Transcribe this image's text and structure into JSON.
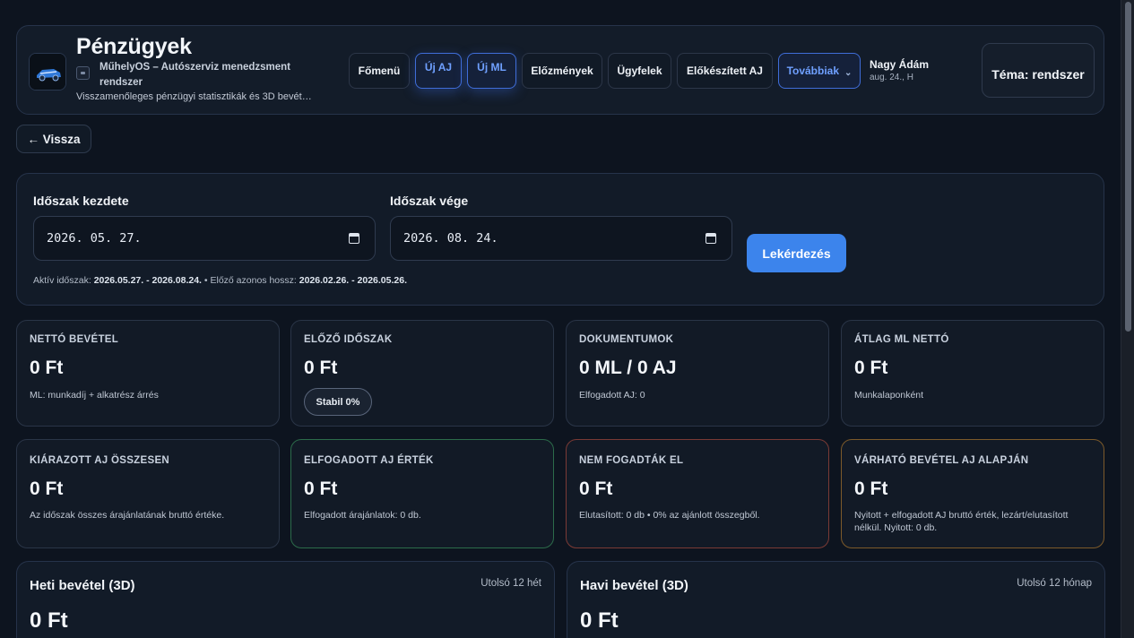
{
  "header": {
    "title": "Pénzügyek",
    "subtitle": "MűhelyOS – Autószerviz menedzsment rendszer",
    "tagline": "Visszamenőleges pénzügyi statisztikák és 3D bevét…",
    "nav": [
      {
        "label": "Főmenü"
      },
      {
        "label": "Új AJ"
      },
      {
        "label": "Új ML"
      },
      {
        "label": "Előzmények"
      },
      {
        "label": "Ügyfelek"
      },
      {
        "label": "Előkészített AJ"
      },
      {
        "label": "Továbbiak"
      }
    ],
    "user_name": "Nagy Ádám",
    "user_date": "aug. 24., H",
    "theme_label": "Téma: rendszer"
  },
  "back_label": "← Vissza",
  "filter": {
    "start_label": "Időszak kezdete",
    "start_value": "2026. 05. 27.",
    "end_label": "Időszak vége",
    "end_value": "2026. 08. 24.",
    "query_label": "Lekérdezés",
    "active_prefix": "Aktív időszak:",
    "active_range": "2026.05.27. - 2026.08.24.",
    "prev_prefix": "• Előző azonos hossz:",
    "prev_range": "2026.02.26. - 2026.05.26."
  },
  "cards_row1": [
    {
      "label": "NETTÓ BEVÉTEL",
      "value": "0 Ft",
      "note": "ML: munkadíj + alkatrész árrés"
    },
    {
      "label": "ELŐZŐ IDŐSZAK",
      "value": "0 Ft",
      "badge": "Stabil 0%"
    },
    {
      "label": "DOKUMENTUMOK",
      "value": "0 ML / 0 AJ",
      "note": "Elfogadott AJ: 0"
    },
    {
      "label": "ÁTLAG ML NETTÓ",
      "value": "0 Ft",
      "note": "Munkalaponként"
    }
  ],
  "cards_row2": [
    {
      "label": "KIÁRAZOTT AJ ÖSSZESEN",
      "value": "0 Ft",
      "note": "Az időszak összes árajánlatának bruttó értéke."
    },
    {
      "label": "ELFOGADOTT AJ ÉRTÉK",
      "value": "0 Ft",
      "note": "Elfogadott árajánlatok: 0 db."
    },
    {
      "label": "NEM FOGADTÁK EL",
      "value": "0 Ft",
      "note": "Elutasított: 0 db • 0% az ajánlott összegből."
    },
    {
      "label": "VÁRHATÓ BEVÉTEL AJ ALAPJÁN",
      "value": "0 Ft",
      "note": "Nyitott + elfogadott AJ bruttó érték, lezárt/elutasított nélkül. Nyitott: 0 db."
    }
  ],
  "weekly": {
    "title": "Heti bevétel (3D)",
    "range": "Utolsó 12 hét",
    "value": "0 Ft"
  },
  "monthly": {
    "title": "Havi bevétel (3D)",
    "range": "Utolsó 12 hónap",
    "value": "0 Ft"
  }
}
